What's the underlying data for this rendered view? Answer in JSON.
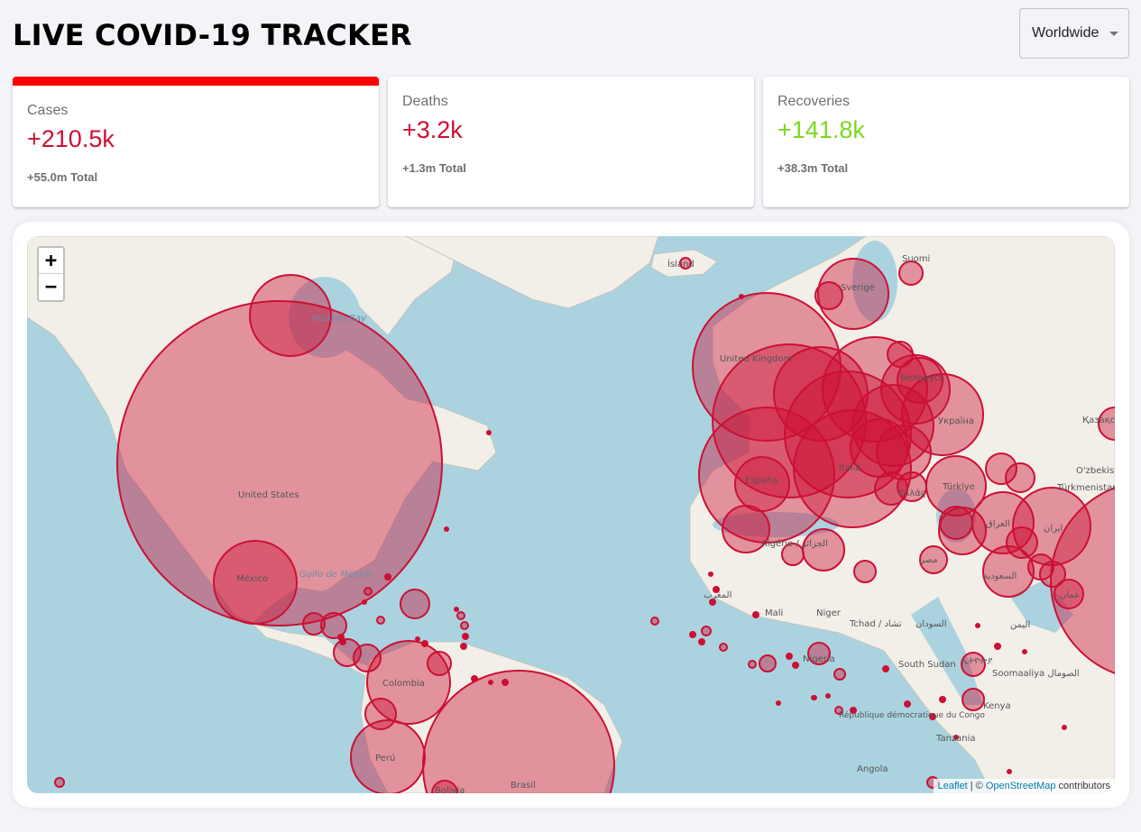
{
  "app": {
    "title": "LIVE COVID-19 TRACKER"
  },
  "country_select": {
    "selected": "Worldwide"
  },
  "cards": [
    {
      "label": "Cases",
      "value": "+210.5k",
      "total": "+55.0m Total"
    },
    {
      "label": "Deaths",
      "value": "+3.2k",
      "total": "+1.3m Total"
    },
    {
      "label": "Recoveries",
      "value": "+141.8k",
      "total": "+38.3m Total"
    }
  ],
  "colors": {
    "cases": "#cc1034",
    "recovered": "#7dd71d",
    "selected_bar": "#ff0000"
  },
  "map": {
    "zoom_in": "+",
    "zoom_out": "−",
    "labels": [
      "Ísland",
      "Suomi",
      "Sverige",
      "United Kingdom",
      "Беларусь",
      "Україна",
      "España",
      "Italia",
      "Ελλάς",
      "Türkiye",
      "Algérie / الجزائر",
      "Türkmenistan",
      "O'zbekiston",
      "العراق",
      "ایران",
      "مصر",
      "السعودية",
      "عمان",
      "Mali",
      "Niger",
      "Tchad / تشاد",
      "السودان",
      "Nigeria",
      "South Sudan",
      "Soomaaliya الصومال",
      "Kenya",
      "République démocratique du Congo",
      "Tanzania",
      "Angola",
      "United States",
      "México",
      "Golfo de México",
      "Hudson Bay",
      "Colombia",
      "Perú",
      "Brasil",
      "Bolivia",
      "Қазақстан",
      "المغرب",
      "ኢትዮጵያ",
      "اليمن"
    ],
    "attribution_leaflet": "Leaflet",
    "attribution_sep": " | © ",
    "attribution_osm": "OpenStreetMap",
    "attribution_tail": " contributors"
  }
}
